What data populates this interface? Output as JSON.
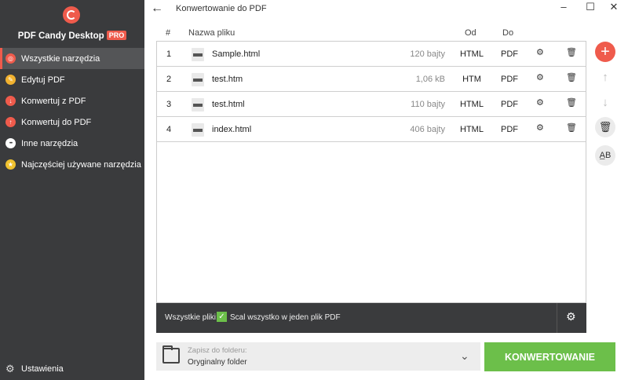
{
  "app": {
    "name": "PDF Candy Desktop",
    "badge": "PRO"
  },
  "sidebar": {
    "items": [
      {
        "label": "Wszystkie narzędzia",
        "icon": "target-icon",
        "color": "#ef5b4c",
        "glyph": "◎",
        "active": true
      },
      {
        "label": "Edytuj PDF",
        "icon": "pencil-icon",
        "color": "#f0b12f",
        "glyph": "✎",
        "active": false
      },
      {
        "label": "Konwertuj z PDF",
        "icon": "arrow-down-icon",
        "color": "#ef5b4c",
        "glyph": "↓",
        "active": false
      },
      {
        "label": "Konwertuj do PDF",
        "icon": "arrow-up-icon",
        "color": "#ef5b4c",
        "glyph": "↑",
        "active": false
      },
      {
        "label": "Inne narzędzia",
        "icon": "more-icon",
        "color": "#ffffff",
        "glyph": "•••",
        "active": false
      },
      {
        "label": "Najczęściej używane narzędzia",
        "icon": "star-icon",
        "color": "#f0c22f",
        "glyph": "★",
        "active": false
      }
    ],
    "settings_label": "Ustawienia"
  },
  "header": {
    "title": "Konwertowanie do PDF"
  },
  "table": {
    "columns": {
      "num": "#",
      "name": "Nazwa pliku",
      "from": "Od",
      "to": "Do"
    },
    "rows": [
      {
        "num": "1",
        "name": "Sample.html",
        "size": "120 bajty",
        "from": "HTML",
        "to": "PDF"
      },
      {
        "num": "2",
        "name": "test.htm",
        "size": "1,06 kB",
        "from": "HTM",
        "to": "PDF"
      },
      {
        "num": "3",
        "name": "test.html",
        "size": "110 bajty",
        "from": "HTML",
        "to": "PDF"
      },
      {
        "num": "4",
        "name": "index.html",
        "size": "406 bajty",
        "from": "HTML",
        "to": "PDF"
      }
    ]
  },
  "footer": {
    "all_files_label": "Wszystkie pliki:",
    "merge_label": "Scal wszystko w jeden plik PDF",
    "merge_checked": true
  },
  "save": {
    "label": "Zapisz do folderu:",
    "value": "Oryginalny folder"
  },
  "convert_button": "KONWERTOWANIE",
  "colors": {
    "accent": "#ef5b4c",
    "green": "#6cbf4a",
    "sidebar": "#3a3b3d"
  }
}
